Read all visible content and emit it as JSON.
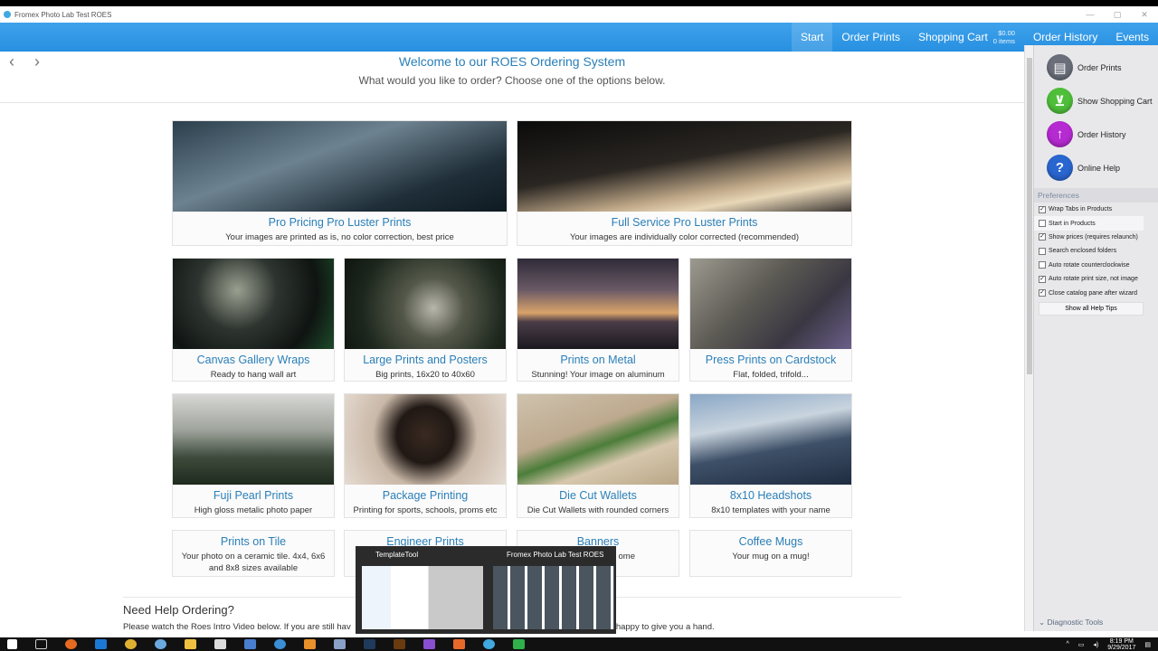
{
  "window": {
    "title": "Fromex Photo Lab Test ROES"
  },
  "nav": {
    "items": [
      "Start",
      "Order Prints",
      "Shopping Cart",
      "Order History",
      "Events"
    ],
    "cart_total": "$0.00",
    "cart_items": "0 items"
  },
  "header": {
    "title": "Welcome to our ROES Ordering System",
    "subtitle": "What would you like to order? Choose one of the options below."
  },
  "products": [
    {
      "title": "Pro Pricing Pro Luster Prints",
      "subtitle": "Your images are printed as is, no color correction, best price"
    },
    {
      "title": "Full Service Pro Luster Prints",
      "subtitle": "Your images are individually color corrected (recommended)"
    },
    {
      "title": "Canvas Gallery Wraps",
      "subtitle": "Ready to hang wall art"
    },
    {
      "title": "Large Prints and Posters",
      "subtitle": "Big prints, 16x20 to 40x60"
    },
    {
      "title": "Prints on Metal",
      "subtitle": "Stunning! Your image on aluminum"
    },
    {
      "title": "Press Prints on Cardstock",
      "subtitle": "Flat, folded, trifold..."
    },
    {
      "title": "Fuji Pearl Prints",
      "subtitle": "High gloss metalic photo paper"
    },
    {
      "title": "Package Printing",
      "subtitle": "Printing for sports, schools, proms etc"
    },
    {
      "title": "Die Cut Wallets",
      "subtitle": "Die Cut Wallets with rounded corners"
    },
    {
      "title": "8x10 Headshots",
      "subtitle": "8x10 templates with your name"
    },
    {
      "title": "Prints on Tile",
      "subtitle": "Your photo on a ceramic tile. 4x4, 6x6 and 8x8 sizes available"
    },
    {
      "title": "Engineer Prints",
      "subtitle": ""
    },
    {
      "title": "Banners",
      "subtitle": "ome"
    },
    {
      "title": "Coffee Mugs",
      "subtitle": "Your mug on a mug!"
    }
  ],
  "help": {
    "title": "Need Help Ordering?",
    "text_left": "Please watch the Roes Intro Video below. If you are still hav",
    "text_right": "we are always happy to give you a hand."
  },
  "sidebar": {
    "buttons": [
      {
        "label": "Order Prints",
        "icon": "printer-icon",
        "color": "#6a6f7a"
      },
      {
        "label": "Show Shopping Cart",
        "icon": "cart-icon",
        "color": "#4fbf3a"
      },
      {
        "label": "Order History",
        "icon": "arrow-up-icon",
        "color": "#b52ad1"
      },
      {
        "label": "Online Help",
        "icon": "question-icon",
        "color": "#2a66d0"
      }
    ],
    "preferences_header": "Preferences",
    "preferences": [
      {
        "label": "Wrap Tabs in Products",
        "checked": true
      },
      {
        "label": "Start in Products",
        "checked": false
      },
      {
        "label": "Show prices (requires relaunch)",
        "checked": true
      },
      {
        "label": "Search enclosed folders",
        "checked": false
      },
      {
        "label": "Auto rotate counterclockwise",
        "checked": false
      },
      {
        "label": "Auto rotate print size, not image",
        "checked": true
      },
      {
        "label": "Close catalog pane after wizard",
        "checked": true
      }
    ],
    "help_tips_button": "Show all Help Tips",
    "diagnostic": "Diagnostic Tools"
  },
  "taskbar_preview": {
    "items": [
      "TemplateTool",
      "Fromex Photo Lab Test ROES"
    ]
  },
  "tray": {
    "time": "8:19 PM",
    "date": "9/29/2017"
  },
  "colors": {
    "accent": "#2a90e0",
    "link": "#2a7fb8"
  }
}
